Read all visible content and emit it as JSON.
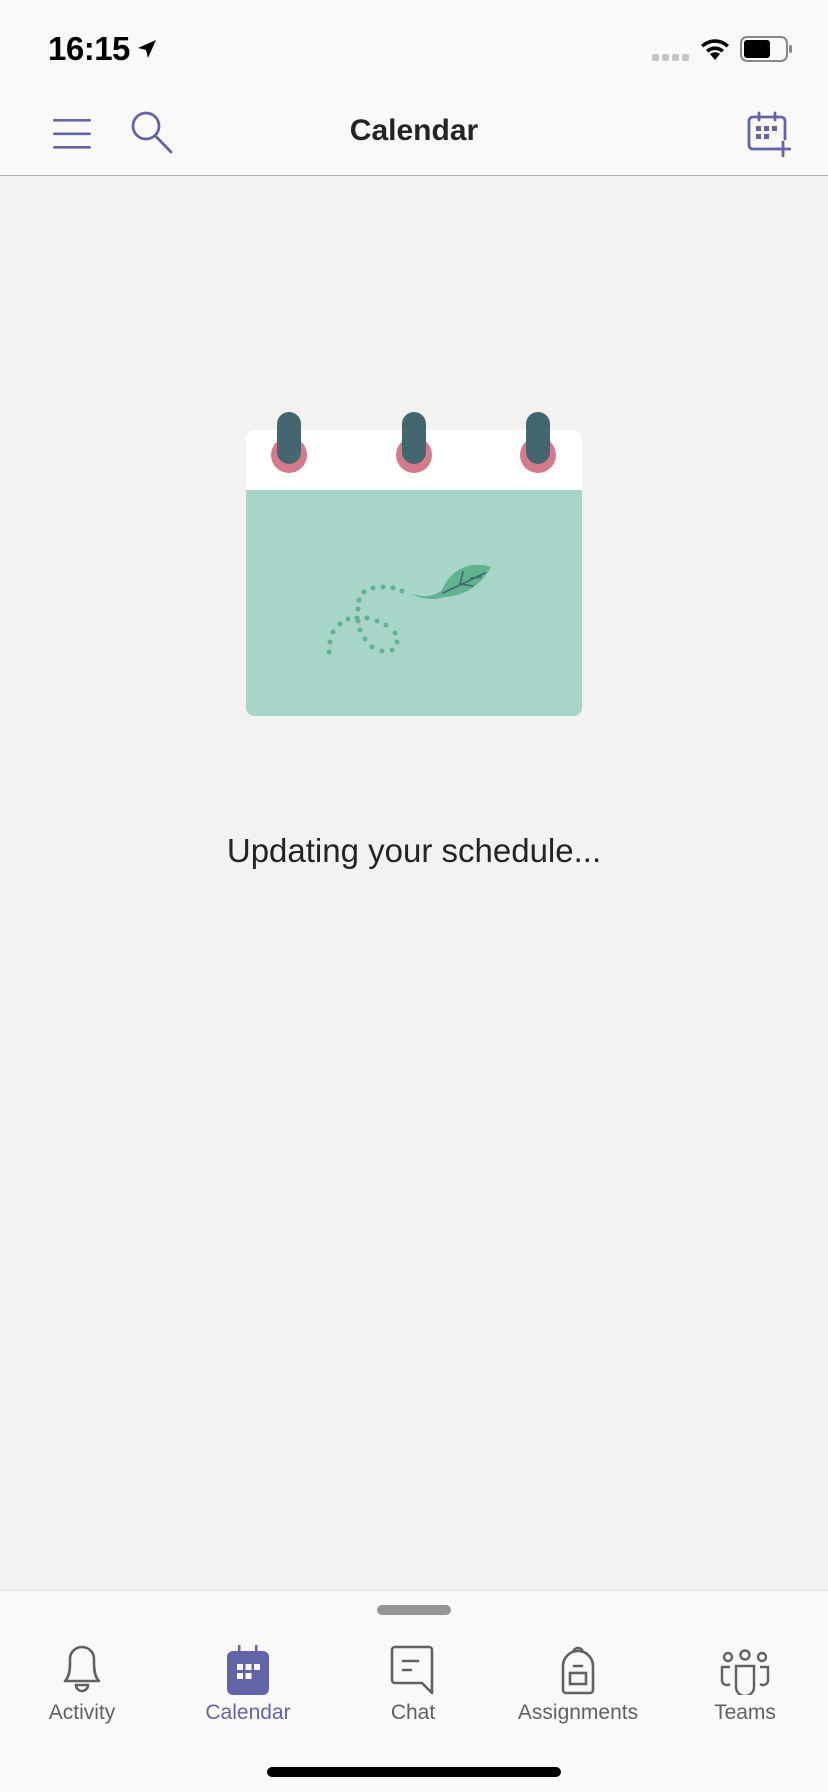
{
  "status_bar": {
    "time": "16:15",
    "location_icon": "location-arrow-icon",
    "signal_icon": "cellular-signal-icon",
    "wifi_icon": "wifi-icon",
    "battery_icon": "battery-icon"
  },
  "nav_bar": {
    "title": "Calendar",
    "left_buttons": [
      {
        "name": "menu",
        "icon": "hamburger-menu-icon"
      },
      {
        "name": "search",
        "icon": "search-icon"
      }
    ],
    "right_button": {
      "name": "new-meeting",
      "icon": "calendar-add-icon"
    }
  },
  "main": {
    "illustration": "calendar-leaf-illustration",
    "message": "Updating your schedule..."
  },
  "tab_bar": {
    "tabs": [
      {
        "label": "Activity",
        "icon": "bell-icon",
        "active": false
      },
      {
        "label": "Calendar",
        "icon": "calendar-icon",
        "active": true
      },
      {
        "label": "Chat",
        "icon": "chat-icon",
        "active": false
      },
      {
        "label": "Assignments",
        "icon": "backpack-icon",
        "active": false
      },
      {
        "label": "Teams",
        "icon": "teams-icon",
        "active": false
      }
    ]
  },
  "colors": {
    "accent": "#6264a7",
    "background": "#f3f2f1",
    "bar_background": "#faf9f8",
    "illustration_green": "#a8d5c9",
    "leaf_green": "#5fb38f",
    "ring_pink": "#d47a8a",
    "ring_post": "#43666f"
  }
}
